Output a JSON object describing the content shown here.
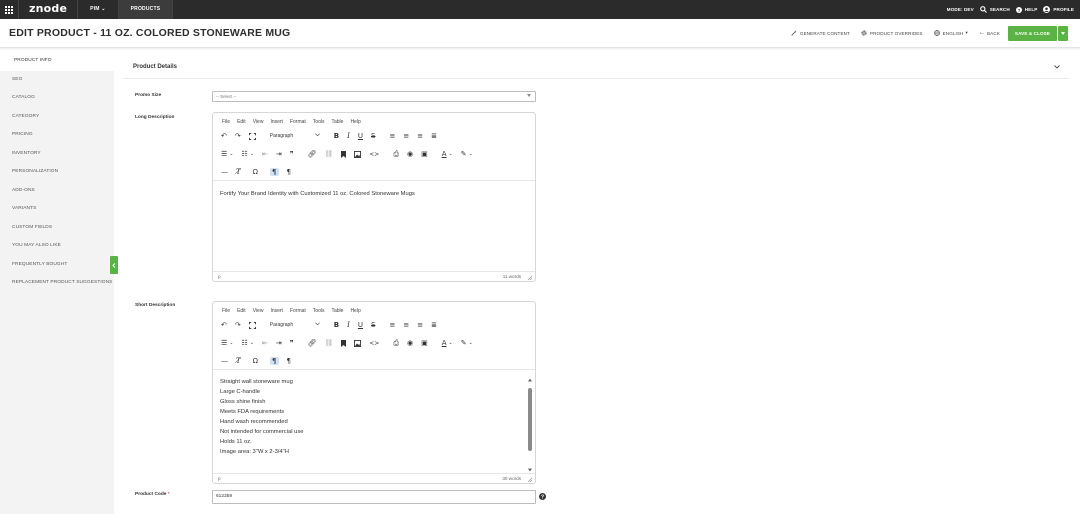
{
  "topnav": {
    "logo": "znode",
    "menus": [
      "PIM",
      "PRODUCTS"
    ],
    "right": [
      "MODE: DEV",
      "SEARCH",
      "HELP",
      "PROFILE"
    ]
  },
  "header": {
    "title": "EDIT PRODUCT - 11 OZ. COLORED STONEWARE MUG",
    "generate": "GENERATE CONTENT",
    "overrides": "PRODUCT OVERRIDES",
    "language": "ENGLISH",
    "back": "BACK",
    "save": "SAVE & CLOSE"
  },
  "sidebar": {
    "items": [
      "PRODUCT INFO",
      "SEO",
      "CATALOG",
      "CATEGORY",
      "PRICING",
      "INVENTORY",
      "PERSONALIZATION",
      "ADD-ONS",
      "VARIANTS",
      "CUSTOM FIELDS",
      "YOU MAY ALSO LIKE",
      "FREQUENTLY BOUGHT",
      "REPLACEMENT PRODUCT SUGGESTIONS"
    ]
  },
  "main": {
    "section_title": "Product Details",
    "promo_size": {
      "label": "Promo Size",
      "value": "-- Select --"
    },
    "long_description": {
      "label": "Long Description",
      "content": [
        "Fortify Your Brand Identity with Customized 11 oz. Colored Stoneware Mugs"
      ],
      "path": "p",
      "word_count": "11 words"
    },
    "short_description": {
      "label": "Short Description",
      "content": [
        "Straight wall stoneware mug",
        "Large C-handle",
        "Gloss shine finish",
        "Meets FDA requirements",
        "Hand wash recommended",
        "Not intended for commercial use",
        "Holds 11 oz.",
        "Image area: 3\"W x 2-3/4\"H"
      ],
      "path": "p",
      "word_count": "30 words"
    },
    "product_code": {
      "label": "Product Code",
      "required_mark": "*",
      "value": "612359"
    }
  },
  "editor": {
    "menus": [
      "File",
      "Edit",
      "View",
      "Insert",
      "Format",
      "Tools",
      "Table",
      "Help"
    ],
    "block_format": "Paragraph"
  },
  "colors": {
    "accent": "#5cb345",
    "topbar": "#2b2b2b"
  }
}
